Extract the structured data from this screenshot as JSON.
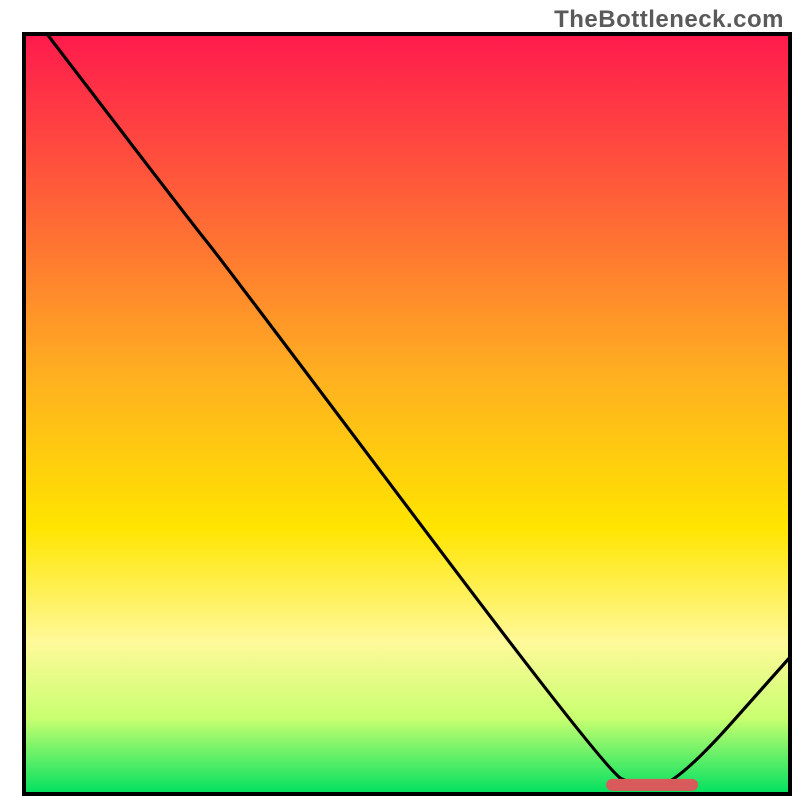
{
  "watermark": "TheBottleneck.com",
  "chart_data": {
    "type": "line",
    "title": "",
    "xlabel": "",
    "ylabel": "",
    "xlim": [
      0,
      100
    ],
    "ylim": [
      0,
      100
    ],
    "background_gradient": {
      "stops": [
        {
          "offset": 0,
          "color": "#ff1a4d"
        },
        {
          "offset": 20,
          "color": "#ff5a3a"
        },
        {
          "offset": 45,
          "color": "#ffb020"
        },
        {
          "offset": 65,
          "color": "#ffe500"
        },
        {
          "offset": 80,
          "color": "#fff99a"
        },
        {
          "offset": 90,
          "color": "#c9ff70"
        },
        {
          "offset": 100,
          "color": "#00e060"
        }
      ]
    },
    "series": [
      {
        "name": "bottleneck-curve",
        "color": "#000000",
        "points": [
          {
            "x": 3,
            "y": 100
          },
          {
            "x": 22,
            "y": 75
          },
          {
            "x": 26,
            "y": 70
          },
          {
            "x": 76,
            "y": 3
          },
          {
            "x": 80,
            "y": 1
          },
          {
            "x": 85,
            "y": 1
          },
          {
            "x": 100,
            "y": 18
          }
        ]
      }
    ],
    "marker": {
      "name": "optimal-range-bar",
      "x_start": 76,
      "x_end": 88,
      "y": 1.2,
      "color": "#d85a5a"
    },
    "border": {
      "color": "#000000",
      "width": 4
    }
  }
}
